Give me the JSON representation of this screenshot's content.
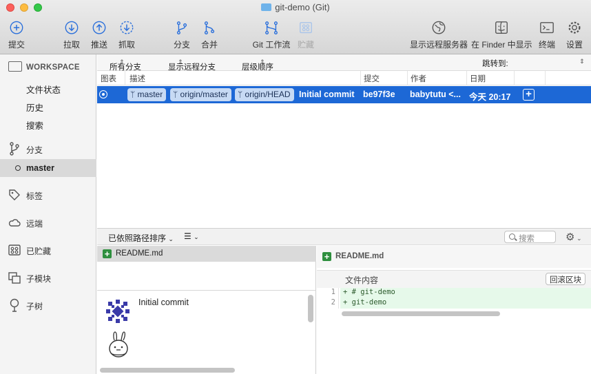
{
  "window": {
    "title": "git-demo (Git)"
  },
  "toolbar": {
    "commit": "提交",
    "pull": "拉取",
    "push": "推送",
    "fetch": "抓取",
    "branch": "分支",
    "merge": "合并",
    "gitflow": "Git 工作流",
    "stash": "贮藏",
    "show_remote": "显示远程服务器",
    "show_in_finder": "在 Finder 中显示",
    "terminal": "终端",
    "settings": "设置"
  },
  "sidebar": {
    "workspace": "WORKSPACE",
    "workspace_items": [
      "文件状态",
      "历史",
      "搜索"
    ],
    "branches": "分支",
    "current_branch": "master",
    "tags": "标签",
    "remotes": "远端",
    "stashes": "已贮藏",
    "submodules": "子模块",
    "subtrees": "子树"
  },
  "filters": {
    "all_branches": "所有分支",
    "show_remote_branches": "显示远程分支",
    "order": "层级顺序",
    "jump_to": "跳转到:"
  },
  "columns": {
    "graph": "图表",
    "description": "描述",
    "commit": "提交",
    "author": "作者",
    "date": "日期"
  },
  "commits": [
    {
      "refs": [
        "master",
        "origin/master",
        "origin/HEAD"
      ],
      "message": "Initial commit",
      "hash": "be97f3e",
      "author": "babytutu <...",
      "date": "今天 20:17"
    }
  ],
  "lower": {
    "sort": "已依照路径排序",
    "search_placeholder": "搜索"
  },
  "files": [
    {
      "status": "added",
      "name": "README.md"
    }
  ],
  "commit_detail": {
    "message": "Initial commit"
  },
  "diff": {
    "file": "README.md",
    "hunk_label": "文件内容",
    "revert_label": "回滚区块",
    "lines": [
      {
        "num": "1",
        "text": "+ # git-demo"
      },
      {
        "num": "2",
        "text": "+ git-demo"
      }
    ]
  },
  "colors": {
    "selection": "#1d68d6",
    "accent": "#2a6fdb",
    "added": "#2e8f3e"
  }
}
